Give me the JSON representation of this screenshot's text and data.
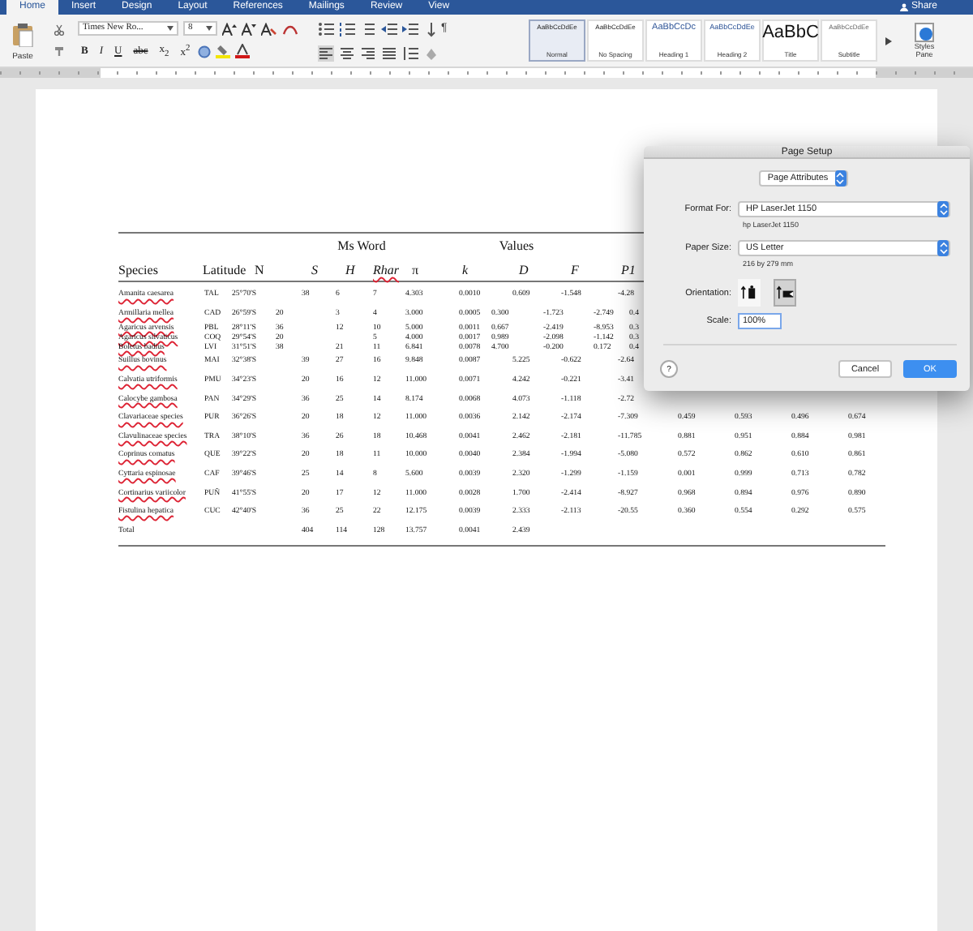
{
  "ribbon": {
    "tabs": [
      {
        "label": "Home",
        "selected": true
      },
      {
        "label": "Insert",
        "selected": false
      },
      {
        "label": "Design",
        "selected": false
      },
      {
        "label": "Layout",
        "selected": false
      },
      {
        "label": "References",
        "selected": false
      },
      {
        "label": "Mailings",
        "selected": false
      },
      {
        "label": "Review",
        "selected": false
      },
      {
        "label": "View",
        "selected": false
      }
    ],
    "share": "Share",
    "paste": "Paste",
    "font": {
      "name": "Times New Ro...",
      "size": "8"
    },
    "format_buttons": [
      {
        "label": "B",
        "kind": "bold"
      },
      {
        "label": "I",
        "kind": "italic"
      },
      {
        "label": "U",
        "kind": "underline"
      },
      {
        "label": "abc",
        "kind": "strike"
      },
      {
        "label": "x$_{2}$",
        "kind": "plain"
      },
      {
        "label": "x$^{2}$",
        "kind": "plain"
      }
    ],
    "pilcrow": "¶",
    "styles": [
      {
        "preview": "AaBbCcDdEe",
        "name": "Normal",
        "kind": "body",
        "selected": true
      },
      {
        "preview": "AaBbCcDdEe",
        "name": "No Spacing",
        "kind": "body",
        "selected": false
      },
      {
        "preview": "AaBbCcDc",
        "name": "Heading 1",
        "kind": "heading",
        "selected": false
      },
      {
        "preview": "AaBbCcDdEe",
        "name": "Heading 2",
        "kind": "heading2",
        "selected": false
      },
      {
        "preview": "AaBbC",
        "name": "Title",
        "kind": "title",
        "selected": false
      },
      {
        "preview": "AaBbCcDdEe",
        "name": "Subtitle",
        "kind": "subtitle",
        "selected": false
      }
    ],
    "styles_pane": "Styles Pane"
  },
  "table": {
    "group_headers": [
      {
        "label": "Ms Word"
      },
      {
        "label": "Values"
      }
    ],
    "columns": [
      {
        "label": "Species"
      },
      {
        "label": "Latitude"
      },
      {
        "label": "N"
      },
      {
        "label": "S"
      },
      {
        "label": "H"
      },
      {
        "label": "Rhar"
      },
      {
        "label": "π"
      },
      {
        "label": "k"
      },
      {
        "label": "D"
      },
      {
        "label": "F"
      },
      {
        "label": "P1"
      }
    ],
    "rows": [
      {
        "kind": "normal",
        "species": "Amanita caesarea",
        "code": "TAL",
        "latitude": "25°70'S",
        "s": "38",
        "h": "6",
        "rhar": "7",
        "pi": "4.303",
        "k": "0.0010",
        "d": "0.609",
        "f": "-1.548",
        "p1": "-4.28"
      },
      {
        "kind": "shifted",
        "species": "Armillaria mellea",
        "code": "CAD",
        "latitude": "26°59'S",
        "n": "20",
        "h": "3",
        "rhar": "4",
        "pi": "3.000",
        "k": "0.0005",
        "d": "0.300",
        "f": "-1.723",
        "p1": "-2.749",
        "column_12": "0.4"
      },
      {
        "kind": "compact",
        "species": "Agaricus arvensis",
        "code": "PBL",
        "latitude": "28°11'S",
        "n": "36",
        "h": "12",
        "rhar": "10",
        "pi": "5.000",
        "k": "0.0011",
        "d": "0.667",
        "f": "-2.419",
        "p1": "-8.953",
        "column_12": "0.3"
      },
      {
        "kind": "compact",
        "species": "Agaricus silvaticus",
        "code": "COQ",
        "latitude": "29°54'S",
        "n": "20",
        "rhar": "5",
        "pi": "4.000",
        "k": "0.0017",
        "d": "0.989",
        "f": "-2.098",
        "p1": "-1.142",
        "column_12": "0.3"
      },
      {
        "kind": "compact",
        "species": "Boletus badius",
        "code": "LVI",
        "latitude": "31°51'S",
        "n": "38",
        "h": "21",
        "rhar": "11",
        "pi": "6.841",
        "k": "0.0078",
        "d": "4.700",
        "f": "-0.200",
        "p1": "0.172",
        "column_12": "0.4"
      },
      {
        "kind": "normal",
        "species": "Suillus bovinus",
        "code": "MAI",
        "latitude": "32°38'S",
        "s": "39",
        "h": "27",
        "rhar": "16",
        "pi": "9.848",
        "k": "0.0087",
        "d": "5.225",
        "f": "-0.622",
        "p1": "-2.64"
      },
      {
        "kind": "normal",
        "species": "Calvatia utriformis",
        "code": "PMU",
        "latitude": "34°23'S",
        "s": "20",
        "h": "16",
        "rhar": "12",
        "pi": "11.000",
        "k": "0.0071",
        "d": "4.242",
        "f": "-0.221",
        "p1": "-3.41"
      },
      {
        "kind": "normal",
        "species": "Calocybe gambosa",
        "code": "PAN",
        "latitude": "34°29'S",
        "s": "36",
        "h": "25",
        "rhar": "14",
        "pi": "8.174",
        "k": "0.0068",
        "d": "4.073",
        "f": "-1.118",
        "p1": "-2.72"
      },
      {
        "kind": "normal",
        "species": "Clavariaceae species",
        "code": "PUR",
        "latitude": "36°26'S",
        "s": "20",
        "h": "18",
        "rhar": "12",
        "pi": "11.000",
        "k": "0.0036",
        "d": "2.142",
        "f": "-2.174",
        "p1": "-7.309",
        "column_12": "0.459",
        "column_13": "0.593",
        "column_14": "0.496",
        "column_15": "0.674"
      },
      {
        "kind": "normal",
        "species": "Clavulinaceae species",
        "code": "TRA",
        "latitude": "38°10'S",
        "s": "36",
        "h": "26",
        "rhar": "18",
        "pi": "10.468",
        "k": "0.0041",
        "d": "2.462",
        "f": "-2.181",
        "p1": "-11.785",
        "column_12": "0.881",
        "column_13": "0.951",
        "column_14": "0.884",
        "column_15": "0.981"
      },
      {
        "kind": "normal",
        "species": "Coprinus comatus",
        "code": "QUE",
        "latitude": "39°22'S",
        "s": "20",
        "h": "18",
        "rhar": "11",
        "pi": "10.000",
        "k": "0.0040",
        "d": "2.384",
        "f": "-1.994",
        "p1": "-5.080",
        "column_12": "0.572",
        "column_13": "0.862",
        "column_14": "0.610",
        "column_15": "0.861"
      },
      {
        "kind": "normal",
        "species": "Cyttaria espinosae",
        "code": "CAF",
        "latitude": "39°46'S",
        "s": "25",
        "h": "14",
        "rhar": "8",
        "pi": "5.600",
        "k": "0.0039",
        "d": "2.320",
        "f": "-1.299",
        "p1": "-1.159",
        "column_12": "0.001",
        "column_13": "0.999",
        "column_14": "0.713",
        "column_15": "0.782"
      },
      {
        "kind": "normal",
        "species": "Cortinarius variicolor",
        "code": "PUÑ",
        "latitude": "41°55'S",
        "s": "20",
        "h": "17",
        "rhar": "12",
        "pi": "11.000",
        "k": "0.0028",
        "d": "1.700",
        "f": "-2.414",
        "p1": "-8.927",
        "column_12": "0.968",
        "column_13": "0.894",
        "column_14": "0.976",
        "column_15": "0.890"
      },
      {
        "kind": "normal",
        "species": "Fistulina hepatica",
        "code": "CUC",
        "latitude": "42°40'S",
        "s": "36",
        "h": "25",
        "rhar": "22",
        "pi": "12.175",
        "k": "0.0039",
        "d": "2.333",
        "f": "-2.113",
        "p1": "-20.55",
        "column_12": "0.360",
        "column_13": "0.554",
        "column_14": "0.292",
        "column_15": "0.575"
      },
      {
        "kind": "total",
        "species": "Total",
        "s": "404",
        "h": "114",
        "rhar": "128",
        "pi": "13.757",
        "k": "0.0041",
        "d": "2.439"
      }
    ]
  },
  "dialog": {
    "title": "Page Setup",
    "section": "Page Attributes",
    "format_label": "Format For:",
    "format_value": "HP LaserJet 1150",
    "format_note": "hp LaserJet 1150",
    "paper_label": "Paper Size:",
    "paper_value": "US Letter",
    "paper_note": "216 by 279 mm",
    "orientation_label": "Orientation:",
    "orientations": [
      {
        "kind": "portrait",
        "selected": false
      },
      {
        "kind": "landscape",
        "selected": true
      }
    ],
    "scale_label": "Scale:",
    "scale_value": "100%",
    "help": "?",
    "cancel": "Cancel",
    "ok": "OK"
  }
}
